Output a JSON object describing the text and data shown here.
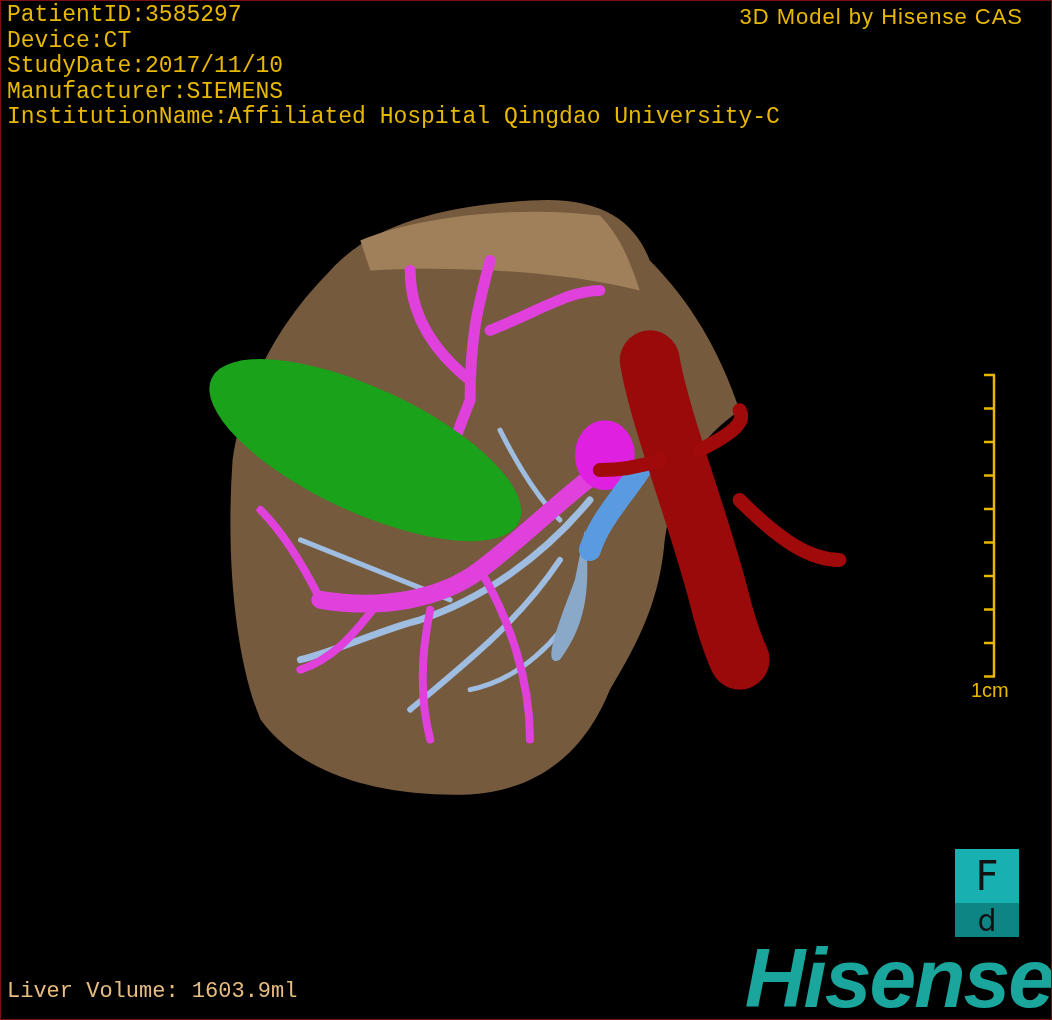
{
  "header": {
    "info_lines": [
      "PatientID:3585297",
      "Device:CT",
      "StudyDate:2017/11/10",
      "Manufacturer:SIEMENS",
      "InstitutionName:Affiliated Hospital Qingdao University-C"
    ],
    "credit": "3D Model by Hisense CAS"
  },
  "scale_bar": {
    "label": "1cm"
  },
  "orientation_cube": {
    "front": "F",
    "bottom": "d"
  },
  "logo": {
    "text": "Hisense"
  },
  "footer": {
    "liver_volume": "Liver Volume: 1603.9ml"
  }
}
